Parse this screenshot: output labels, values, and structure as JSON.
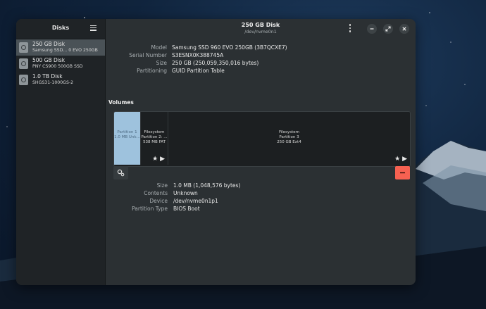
{
  "sidebar": {
    "title": "Disks",
    "disks": [
      {
        "name": "250 GB Disk",
        "model": "Samsung SSD... 0 EVO 250GB"
      },
      {
        "name": "500 GB Disk",
        "model": "PNY CS900 500GB SSD"
      },
      {
        "name": "1.0 TB Disk",
        "model": "SHGS31-1000GS-2"
      }
    ]
  },
  "header": {
    "title": "250 GB Disk",
    "subtitle": "/dev/nvme0n1"
  },
  "drive": {
    "model_label": "Model",
    "model_value": "Samsung SSD 960 EVO 250GB (3B7QCXE7)",
    "serial_label": "Serial Number",
    "serial_value": "S3ESNX0K388745A",
    "size_label": "Size",
    "size_value": "250 GB (250,059,350,016 bytes)",
    "partitioning_label": "Partitioning",
    "partitioning_value": "GUID Partition Table"
  },
  "volumes": {
    "title": "Volumes",
    "partitions": [
      {
        "line1": "Partition 1",
        "line2": "1.0 MB Unk..."
      },
      {
        "line1": "Filesystem",
        "line2": "Partition 2: ...",
        "line3": "538 MB FAT"
      },
      {
        "line1": "Filesystem",
        "line2": "Partition 3",
        "line3": "250 GB Ext4"
      }
    ]
  },
  "selected_partition": {
    "size_label": "Size",
    "size_value": "1.0 MB (1,048,576 bytes)",
    "contents_label": "Contents",
    "contents_value": "Unknown",
    "device_label": "Device",
    "device_value": "/dev/nvme0n1p1",
    "type_label": "Partition Type",
    "type_value": "BIOS Boot"
  },
  "icons": {
    "menu": "hamburger-icon",
    "more": "kebab-menu-icon",
    "minimize": "minimize-icon",
    "maximize": "maximize-icon",
    "close": "close-icon",
    "mount": "play-icon",
    "favorite": "star-icon",
    "settings": "gears-icon",
    "delete": "minus-icon"
  },
  "colors": {
    "accent_partition": "#9ec2dd",
    "delete_button": "#f66151",
    "selected_row": "#4a5257"
  }
}
